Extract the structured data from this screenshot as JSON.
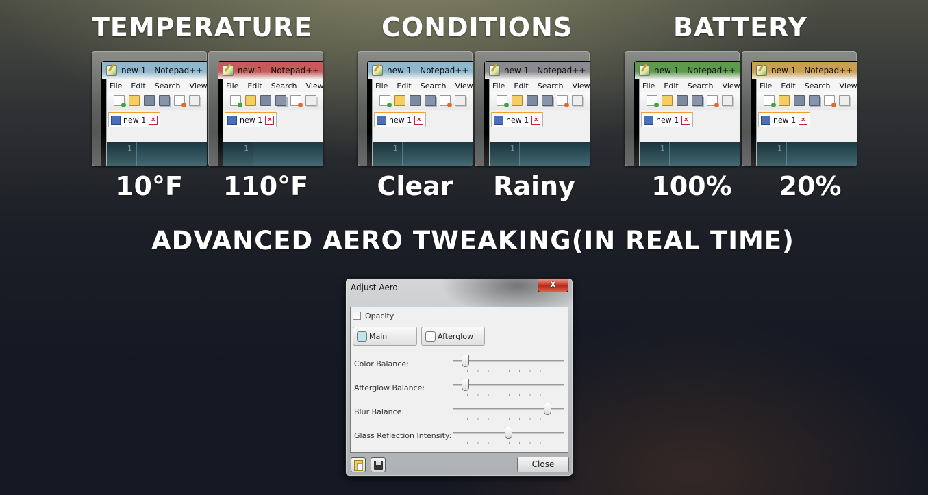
{
  "headings": {
    "temperature": "TEMPERATURE",
    "conditions": "CONDITIONS",
    "battery": "BATTERY",
    "advanced": "ADVANCED AERO TWEAKING(IN REAL TIME)"
  },
  "captions": [
    "10°F",
    "110°F",
    "Clear",
    "Rainy",
    "100%",
    "20%"
  ],
  "notepad": {
    "title": "new  1 - Notepad++",
    "menu": [
      "File",
      "Edit",
      "Search",
      "View"
    ],
    "tab_label": "new  1",
    "line_number": "1"
  },
  "thumb_colors": [
    "#8fb8cf",
    "#c85a5a",
    "#8fb8cf",
    "#8a8a90",
    "#5c9a4c",
    "#c9a050"
  ],
  "dialog": {
    "title": "Adjust Aero",
    "close_glyph": "x",
    "opacity_label": "Opacity",
    "main_label": "Main",
    "main_swatch": "#bfe5ef",
    "afterglow_label": "Afterglow",
    "afterglow_swatch": "#ffffff",
    "sliders": [
      {
        "label": "Color Balance:",
        "value": 0.08
      },
      {
        "label": "Afterglow Balance:",
        "value": 0.08
      },
      {
        "label": "Blur Balance:",
        "value": 0.88
      },
      {
        "label": "Glass Reflection Intensity:",
        "value": 0.5
      }
    ],
    "close_button": "Close"
  }
}
